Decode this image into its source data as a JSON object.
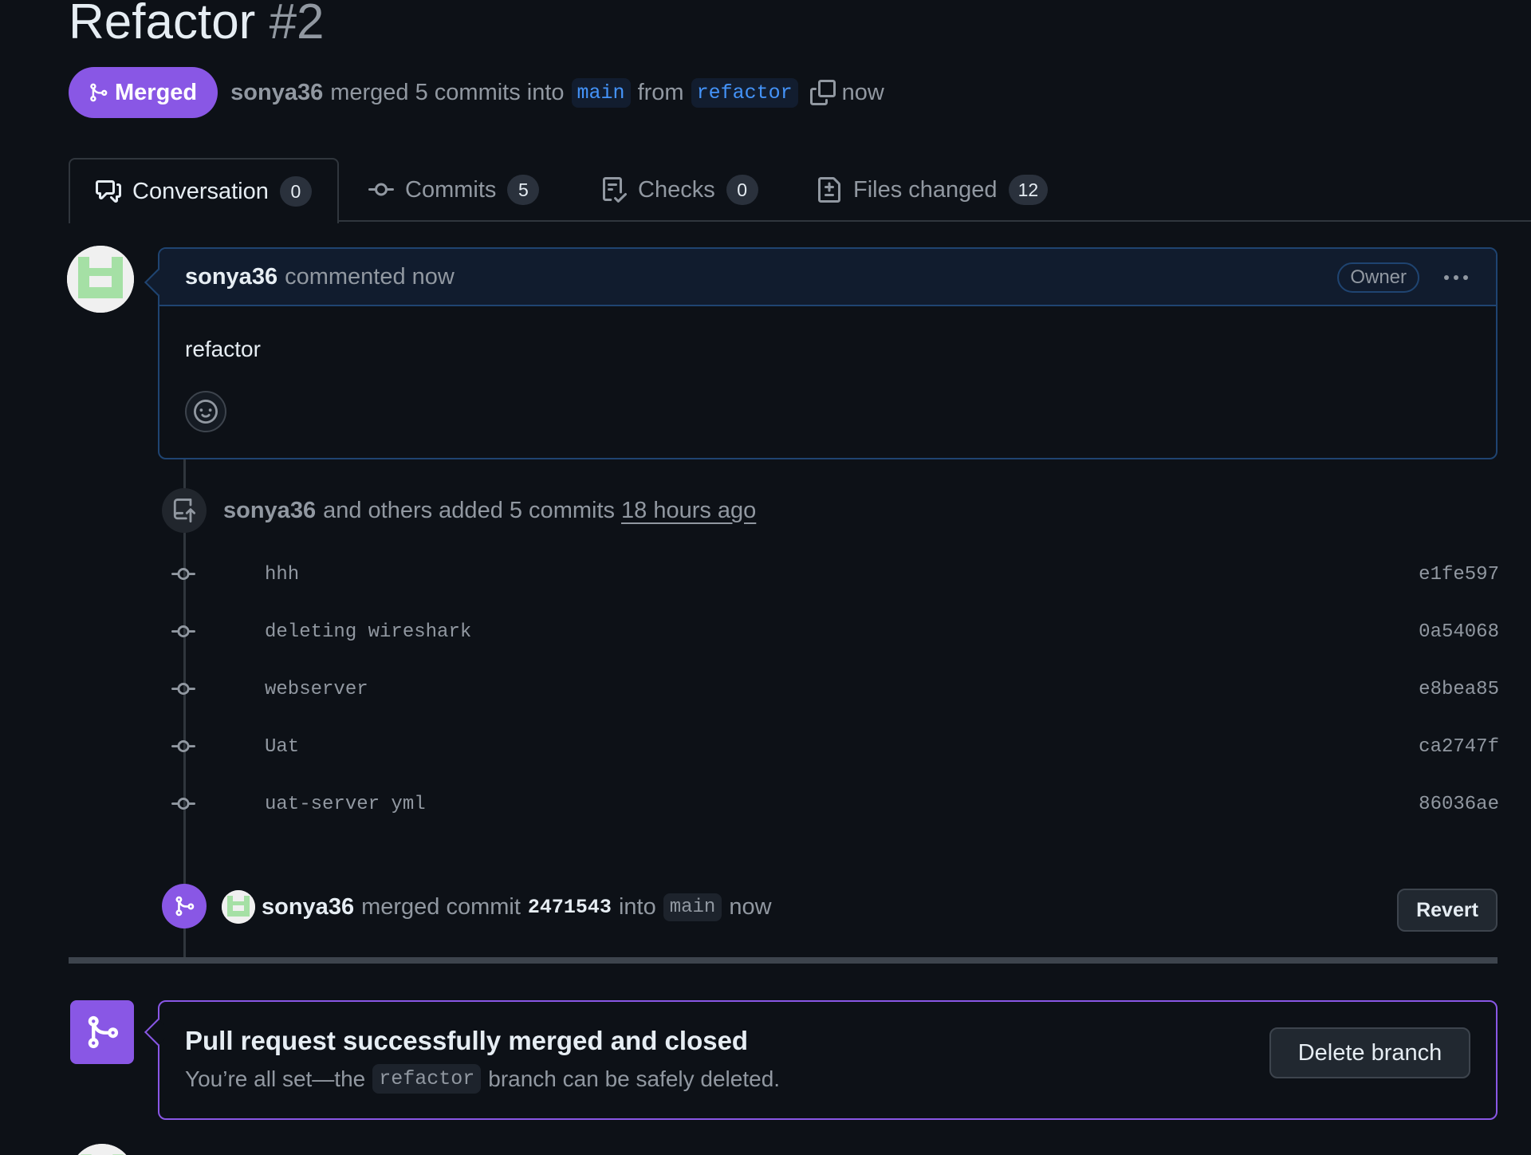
{
  "pr": {
    "title": "Refactor",
    "number": "#2",
    "state": "Merged",
    "author": "sonya36",
    "merged_text": "merged 5 commits into",
    "base_branch": "main",
    "from_text": "from",
    "head_branch": "refactor",
    "time": "now"
  },
  "tabs": [
    {
      "label": "Conversation",
      "count": "0"
    },
    {
      "label": "Commits",
      "count": "5"
    },
    {
      "label": "Checks",
      "count": "0"
    },
    {
      "label": "Files changed",
      "count": "12"
    }
  ],
  "comment": {
    "author": "sonya36",
    "action": "commented now",
    "role": "Owner",
    "body": "refactor"
  },
  "commits_event": {
    "author": "sonya36",
    "text": "and others added 5 commits",
    "time": "18 hours ago",
    "commits": [
      {
        "message": "hhh",
        "sha": "e1fe597"
      },
      {
        "message": "deleting wireshark",
        "sha": "0a54068"
      },
      {
        "message": "webserver",
        "sha": "e8bea85"
      },
      {
        "message": "Uat",
        "sha": "ca2747f"
      },
      {
        "message": "uat-server yml",
        "sha": "86036ae"
      }
    ]
  },
  "merge_event": {
    "author": "sonya36",
    "text": "merged commit",
    "sha": "2471543",
    "into_text": "into",
    "branch": "main",
    "time": "now",
    "revert_label": "Revert"
  },
  "merged_box": {
    "title": "Pull request successfully merged and closed",
    "sub_before": "You’re all set—the",
    "branch": "refactor",
    "sub_after": "branch can be safely deleted.",
    "delete_label": "Delete branch"
  },
  "colors": {
    "background": "#0d1117",
    "merged_purple": "#8957e5",
    "link_blue": "#4493f8"
  }
}
